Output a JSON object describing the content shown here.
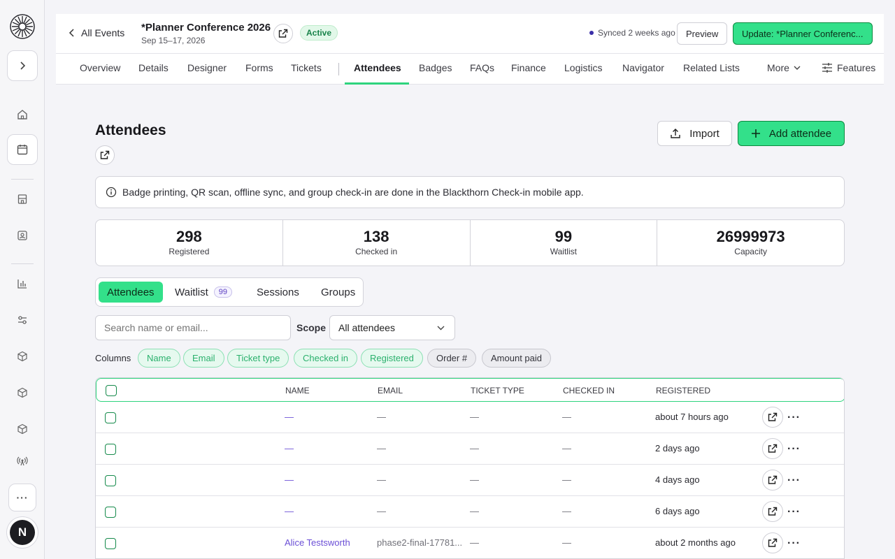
{
  "rail": {
    "avatar_initial": "N"
  },
  "header": {
    "back_label": "All Events",
    "event_title": "*Planner Conference 2026",
    "event_dates": "Sep 15–17, 2026",
    "status": "Active",
    "synced": "Synced 2 weeks ago",
    "preview_label": "Preview",
    "update_label": "Update: *Planner Conferenc..."
  },
  "tabs": {
    "items": [
      "Overview",
      "Details",
      "Designer",
      "Forms",
      "Tickets",
      "Attendees",
      "Badges",
      "FAQs",
      "Finance",
      "Logistics",
      "Navigator",
      "Related Lists"
    ],
    "active": "Attendees",
    "more_label": "More",
    "features_label": "Features"
  },
  "page": {
    "title": "Attendees",
    "import_label": "Import",
    "add_label": "Add attendee",
    "info_text": "Badge printing, QR scan, offline sync, and group check-in are done in the Blackthorn Check-in mobile app."
  },
  "stats": [
    {
      "value": "298",
      "label": "Registered"
    },
    {
      "value": "138",
      "label": "Checked in"
    },
    {
      "value": "99",
      "label": "Waitlist"
    },
    {
      "value": "26999973",
      "label": "Capacity"
    }
  ],
  "subtabs": {
    "attendees": "Attendees",
    "waitlist": "Waitlist",
    "waitlist_count": "99",
    "sessions": "Sessions",
    "groups": "Groups"
  },
  "filters": {
    "search_placeholder": "Search name or email...",
    "scope_label": "Scope",
    "scope_value": "All attendees",
    "columns_label": "Columns",
    "chips": [
      "Name",
      "Email",
      "Ticket type",
      "Checked in",
      "Registered",
      "Order #",
      "Amount paid"
    ]
  },
  "table": {
    "headers": {
      "name": "NAME",
      "email": "EMAIL",
      "ticket": "TICKET TYPE",
      "checked": "CHECKED IN",
      "registered": "REGISTERED"
    },
    "rows": [
      {
        "name": "—",
        "email": "—",
        "ticket": "—",
        "checked": "—",
        "registered": "about 7 hours ago"
      },
      {
        "name": "—",
        "email": "—",
        "ticket": "—",
        "checked": "—",
        "registered": "2 days ago"
      },
      {
        "name": "—",
        "email": "—",
        "ticket": "—",
        "checked": "—",
        "registered": "4 days ago"
      },
      {
        "name": "—",
        "email": "—",
        "ticket": "—",
        "checked": "—",
        "registered": "6 days ago"
      },
      {
        "name": "Alice Testsworth",
        "email": "phase2-final-17781...",
        "ticket": "—",
        "checked": "—",
        "registered": "about 2 months ago"
      }
    ]
  },
  "colors": {
    "accent": "#33e08a",
    "link": "#6b4fd6"
  }
}
